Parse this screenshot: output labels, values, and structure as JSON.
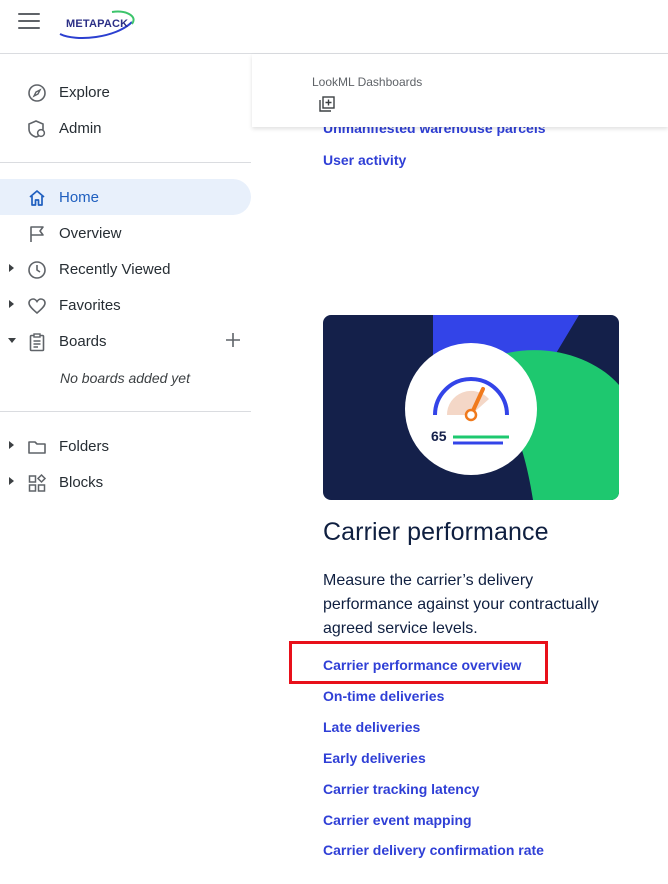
{
  "header": {
    "logo_text": "METAPACK"
  },
  "sidebar": {
    "primary": [
      {
        "label": "Explore",
        "icon": "compass-icon"
      },
      {
        "label": "Admin",
        "icon": "shield-gear-icon"
      }
    ],
    "nav": [
      {
        "label": "Home",
        "icon": "home-icon",
        "active": true
      },
      {
        "label": "Overview",
        "icon": "flag-icon"
      },
      {
        "label": "Recently Viewed",
        "icon": "clock-icon"
      },
      {
        "label": "Favorites",
        "icon": "heart-icon"
      },
      {
        "label": "Boards",
        "icon": "clipboard-icon"
      }
    ],
    "boards_empty": "No boards added yet",
    "secondary": [
      {
        "label": "Folders",
        "icon": "folder-icon"
      },
      {
        "label": "Blocks",
        "icon": "blocks-icon"
      }
    ]
  },
  "main": {
    "section_title": "LookML Dashboards",
    "links_above": [
      "Unmanifested warehouse parcels",
      "User activity"
    ],
    "card": {
      "gauge_value": "65",
      "title": "Carrier performance",
      "description": "Measure the carrier’s delivery performance against your contractually agreed service levels.",
      "links": [
        "Carrier performance overview",
        "On-time deliveries",
        "Late deliveries",
        "Early deliveries",
        "Carrier tracking latency",
        "Carrier event mapping",
        "Carrier delivery confirmation rate"
      ]
    },
    "colors": {
      "link": "#2f3fd6",
      "card_dark": "#14204a",
      "card_green": "#1ec86f",
      "card_blue": "#3344e8",
      "gauge_accent": "#f07a1d",
      "highlight": "#e8101a"
    }
  }
}
